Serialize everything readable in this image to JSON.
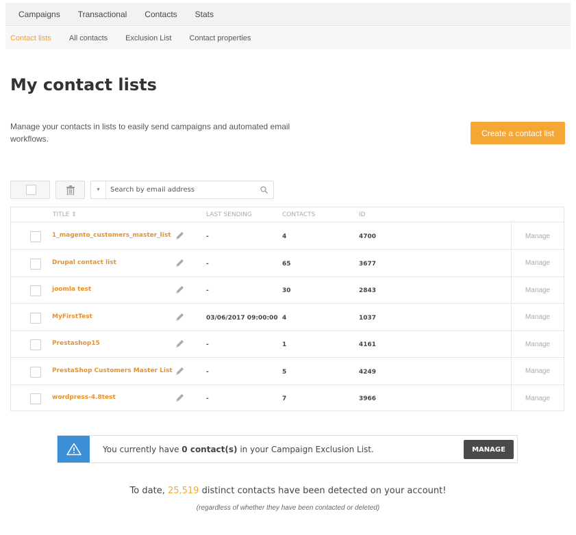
{
  "top_nav": [
    "Campaigns",
    "Transactional",
    "Contacts",
    "Stats"
  ],
  "sub_nav": [
    "Contact lists",
    "All contacts",
    "Exclusion List",
    "Contact properties"
  ],
  "page": {
    "title": "My contact lists",
    "description": "Manage your contacts in lists to easily send campaigns and automated email workflows.",
    "create_button": "Create a contact list"
  },
  "search": {
    "placeholder": "Search by email address"
  },
  "table": {
    "headers": {
      "title": "TITLE ⇕",
      "last_sending": "LAST SENDING",
      "contacts": "CONTACTS",
      "id": "ID"
    },
    "manage_label": "Manage",
    "rows": [
      {
        "name": "1_magento_customers_master_list",
        "last_sending": "-",
        "contacts": "4",
        "id": "4700"
      },
      {
        "name": "Drupal contact list",
        "last_sending": "-",
        "contacts": "65",
        "id": "3677"
      },
      {
        "name": "joomla test",
        "last_sending": "-",
        "contacts": "30",
        "id": "2843"
      },
      {
        "name": "MyFirstTest",
        "last_sending": "03/06/2017 09:00:00",
        "contacts": "4",
        "id": "1037"
      },
      {
        "name": "Prestashop15",
        "last_sending": "-",
        "contacts": "1",
        "id": "4161"
      },
      {
        "name": "PrestaShop Customers Master List",
        "last_sending": "-",
        "contacts": "5",
        "id": "4249"
      },
      {
        "name": "wordpress-4.8test",
        "last_sending": "-",
        "contacts": "7",
        "id": "3966"
      }
    ]
  },
  "exclusion_alert": {
    "prefix": "You currently have ",
    "count": "0 contact(s)",
    "suffix": " in your Campaign Exclusion List.",
    "button": "MANAGE"
  },
  "summary": {
    "prefix": "To date, ",
    "count": "25,519",
    "suffix": " distinct contacts have been detected on your account!",
    "note": "(regardless of whether they have been contacted or deleted)"
  },
  "colors": {
    "accent": "#f5a735",
    "link": "#e8902a",
    "alert_icon_bg": "#3b8fd6",
    "dark_button": "#4a4a4a"
  }
}
